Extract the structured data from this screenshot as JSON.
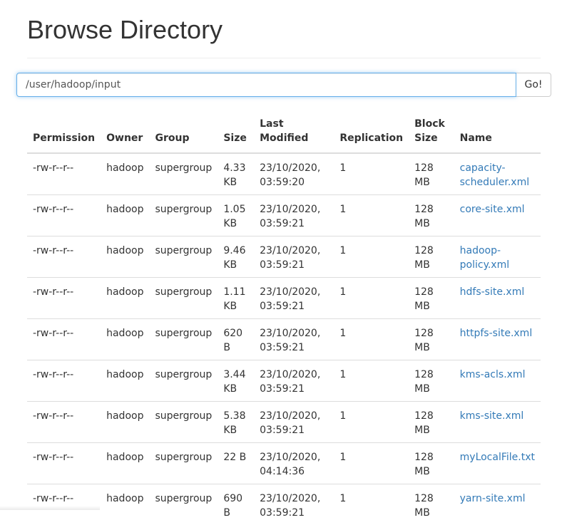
{
  "header": {
    "title": "Browse Directory"
  },
  "path_bar": {
    "value": "/user/hadoop/input",
    "go_label": "Go!"
  },
  "table": {
    "columns": [
      "Permission",
      "Owner",
      "Group",
      "Size",
      "Last Modified",
      "Replication",
      "Block Size",
      "Name"
    ],
    "rows": [
      {
        "permission": "-rw-r--r--",
        "owner": "hadoop",
        "group": "supergroup",
        "size": "4.33 KB",
        "modified": "23/10/2020, 03:59:20",
        "replication": "1",
        "block_size": "128 MB",
        "name": "capacity-scheduler.xml"
      },
      {
        "permission": "-rw-r--r--",
        "owner": "hadoop",
        "group": "supergroup",
        "size": "1.05 KB",
        "modified": "23/10/2020, 03:59:21",
        "replication": "1",
        "block_size": "128 MB",
        "name": "core-site.xml"
      },
      {
        "permission": "-rw-r--r--",
        "owner": "hadoop",
        "group": "supergroup",
        "size": "9.46 KB",
        "modified": "23/10/2020, 03:59:21",
        "replication": "1",
        "block_size": "128 MB",
        "name": "hadoop-policy.xml"
      },
      {
        "permission": "-rw-r--r--",
        "owner": "hadoop",
        "group": "supergroup",
        "size": "1.11 KB",
        "modified": "23/10/2020, 03:59:21",
        "replication": "1",
        "block_size": "128 MB",
        "name": "hdfs-site.xml"
      },
      {
        "permission": "-rw-r--r--",
        "owner": "hadoop",
        "group": "supergroup",
        "size": "620 B",
        "modified": "23/10/2020, 03:59:21",
        "replication": "1",
        "block_size": "128 MB",
        "name": "httpfs-site.xml"
      },
      {
        "permission": "-rw-r--r--",
        "owner": "hadoop",
        "group": "supergroup",
        "size": "3.44 KB",
        "modified": "23/10/2020, 03:59:21",
        "replication": "1",
        "block_size": "128 MB",
        "name": "kms-acls.xml"
      },
      {
        "permission": "-rw-r--r--",
        "owner": "hadoop",
        "group": "supergroup",
        "size": "5.38 KB",
        "modified": "23/10/2020, 03:59:21",
        "replication": "1",
        "block_size": "128 MB",
        "name": "kms-site.xml"
      },
      {
        "permission": "-rw-r--r--",
        "owner": "hadoop",
        "group": "supergroup",
        "size": "22 B",
        "modified": "23/10/2020, 04:14:36",
        "replication": "1",
        "block_size": "128 MB",
        "name": "myLocalFile.txt"
      },
      {
        "permission": "-rw-r--r--",
        "owner": "hadoop",
        "group": "supergroup",
        "size": "690 B",
        "modified": "23/10/2020, 03:59:21",
        "replication": "1",
        "block_size": "128 MB",
        "name": "yarn-site.xml"
      }
    ]
  },
  "colors": {
    "link": "#337ab7",
    "focus_border": "#66afe9",
    "rule": "#dddddd"
  }
}
